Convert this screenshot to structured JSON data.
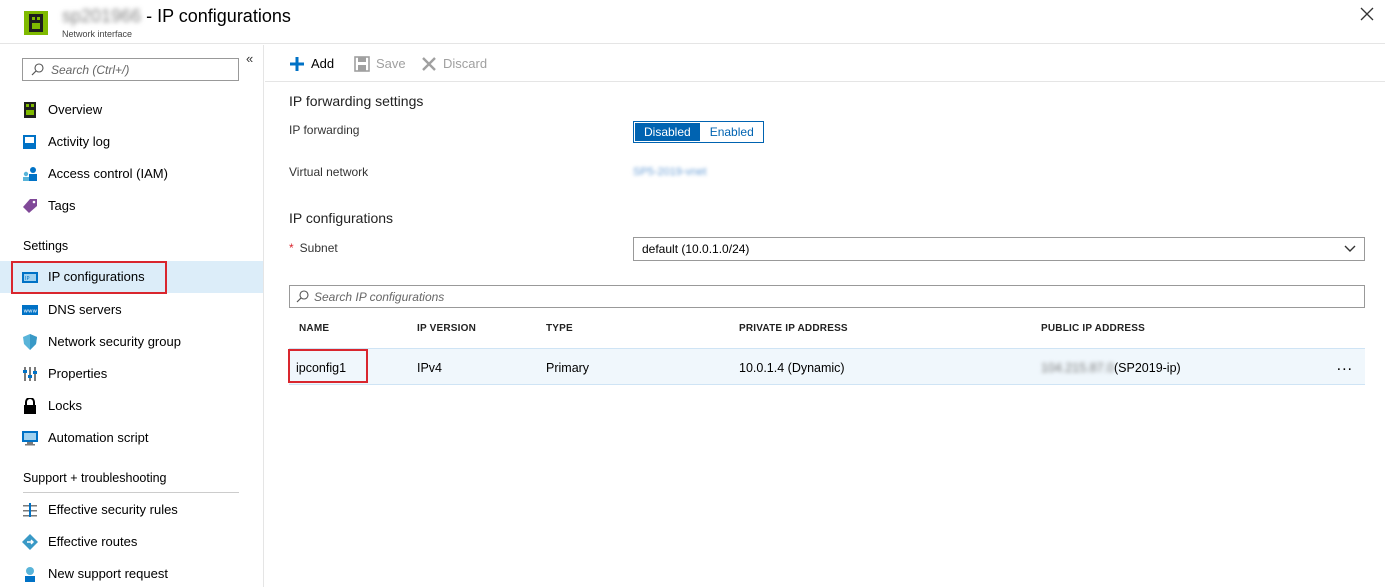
{
  "header": {
    "resource_name": "sp201966",
    "title_suffix": "- IP configurations",
    "subtitle": "Network interface"
  },
  "sidebar": {
    "search_placeholder": "Search (Ctrl+/)",
    "collapse_label": "«",
    "items_top": [
      {
        "label": "Overview",
        "icon": "nic-icon"
      },
      {
        "label": "Activity log",
        "icon": "activity-log-icon"
      },
      {
        "label": "Access control (IAM)",
        "icon": "people-icon"
      },
      {
        "label": "Tags",
        "icon": "tag-icon"
      }
    ],
    "settings_header": "Settings",
    "settings_items": [
      {
        "label": "IP configurations",
        "icon": "ip-config-icon",
        "active": true
      },
      {
        "label": "DNS servers",
        "icon": "dns-icon"
      },
      {
        "label": "Network security group",
        "icon": "shield-icon"
      },
      {
        "label": "Properties",
        "icon": "properties-icon"
      },
      {
        "label": "Locks",
        "icon": "lock-icon"
      },
      {
        "label": "Automation script",
        "icon": "script-icon"
      }
    ],
    "support_header": "Support + troubleshooting",
    "support_items": [
      {
        "label": "Effective security rules",
        "icon": "rules-icon"
      },
      {
        "label": "Effective routes",
        "icon": "routes-icon"
      },
      {
        "label": "New support request",
        "icon": "support-icon"
      }
    ]
  },
  "toolbar": {
    "add_label": "Add",
    "save_label": "Save",
    "discard_label": "Discard"
  },
  "forwarding": {
    "section_title": "IP forwarding settings",
    "ip_forwarding_label": "IP forwarding",
    "option_disabled": "Disabled",
    "option_enabled": "Enabled",
    "selected": "Disabled",
    "vnet_label": "Virtual network",
    "vnet_value": "SP5-2019-vnet"
  },
  "ipconfig": {
    "section_title": "IP configurations",
    "subnet_required": "*",
    "subnet_label": "Subnet",
    "subnet_value": "default (10.0.1.0/24)",
    "search_placeholder": "Search IP configurations",
    "columns": [
      "NAME",
      "IP VERSION",
      "TYPE",
      "PRIVATE IP ADDRESS",
      "PUBLIC IP ADDRESS"
    ],
    "rows": [
      {
        "name": "ipconfig1",
        "ip_version": "IPv4",
        "type": "Primary",
        "private_ip": "10.0.1.4 (Dynamic)",
        "public_ip_value": "104.215.87.0",
        "public_ip_name": "(SP2019-ip)",
        "more": "..."
      }
    ]
  },
  "colors": {
    "accent": "#0063b1",
    "highlight_box": "#d9262e",
    "active_nav": "#dcedf9"
  }
}
